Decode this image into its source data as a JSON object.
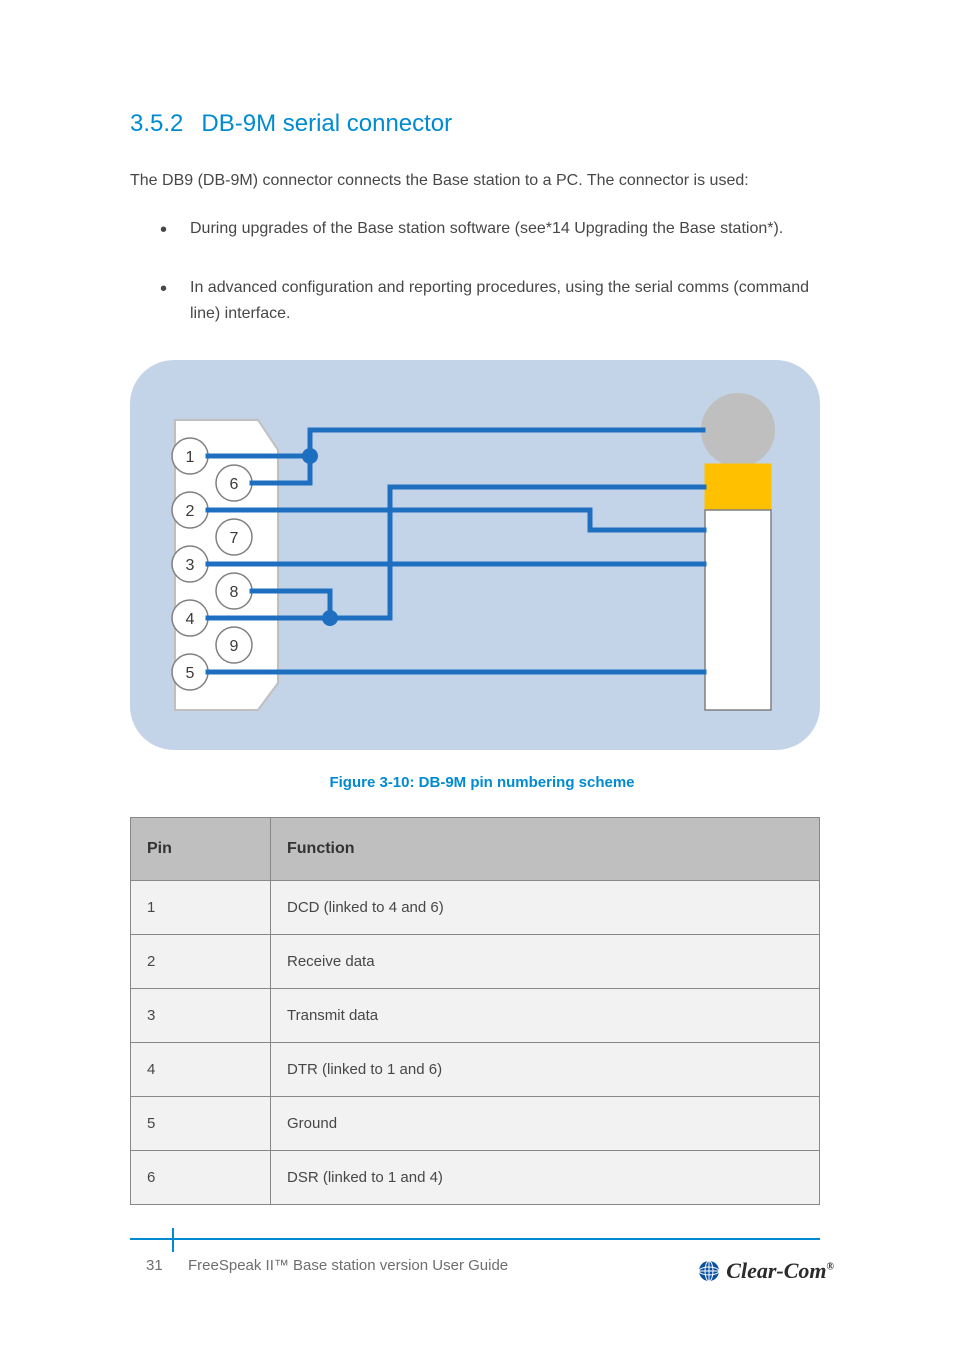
{
  "section": {
    "number": "3.5.2",
    "title": "DB-9M serial connector"
  },
  "paragraph": "The DB9 (DB-9M) connector connects the Base station to a PC. The connector is used:",
  "bullets": [
    "During upgrades of the Base station software (see*14 Upgrading the Base station*).",
    "In advanced configuration and reporting procedures, using the serial comms (command line) interface."
  ],
  "diagram": {
    "pin_numbers": [
      "1",
      "2",
      "3",
      "4",
      "5",
      "6",
      "7",
      "8",
      "9"
    ],
    "jack_parts": [
      {
        "fill": "#bfbfbf",
        "stroke": "#bfbfbf"
      },
      {
        "fill": "#ffc000",
        "stroke": "#ffc000"
      },
      {
        "fill": "#ffffff",
        "stroke": "#808080"
      }
    ]
  },
  "figure_caption": "Figure 3-10: DB-9M pin numbering scheme",
  "table": {
    "headers": [
      "Pin",
      "Function"
    ],
    "rows": [
      [
        "1",
        "DCD (linked to 4 and 6)"
      ],
      [
        "2",
        "Receive data"
      ],
      [
        "3",
        "Transmit data"
      ],
      [
        "4",
        "DTR (linked to 1 and 6)"
      ],
      [
        "5",
        "Ground"
      ],
      [
        "6",
        "DSR (linked to 1 and 4)"
      ]
    ]
  },
  "footer": {
    "page": "31",
    "title": "FreeSpeak II™ Base station version User Guide",
    "logo_text": "Clear-Com",
    "logo_reg": "®"
  }
}
